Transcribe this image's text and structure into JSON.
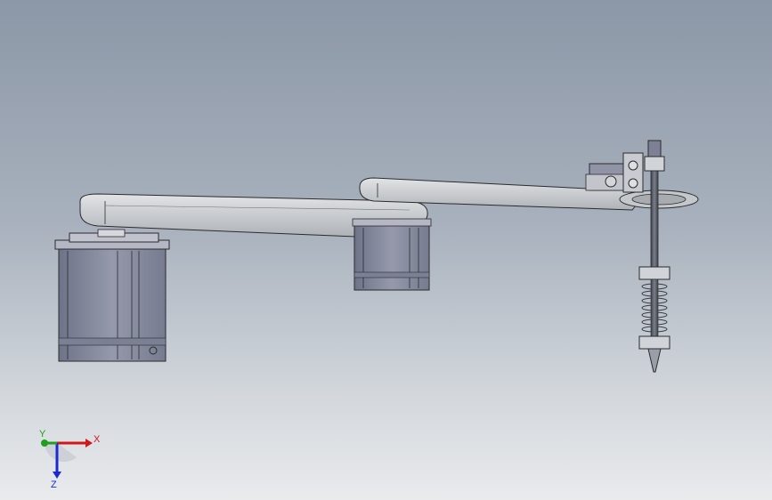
{
  "viewport": {
    "background_top": "#8c97a7",
    "background_bottom": "#e9ebed"
  },
  "model": {
    "parts": [
      "base-stepper-motor",
      "first-arm-link",
      "elbow-stepper-motor",
      "second-arm-link",
      "end-effector-bracket",
      "lead-screw",
      "spring-nozzle"
    ],
    "colors": {
      "link": "#c9cdd1",
      "motor": "#8a8e9f",
      "outline": "#2b2b2b",
      "screw": "#555a66"
    }
  },
  "triad": {
    "x_label": "X",
    "y_label": "Y",
    "z_label": "Z",
    "x_color": "#d01818",
    "y_color": "#1ea01e",
    "z_color": "#1a2ad0"
  }
}
